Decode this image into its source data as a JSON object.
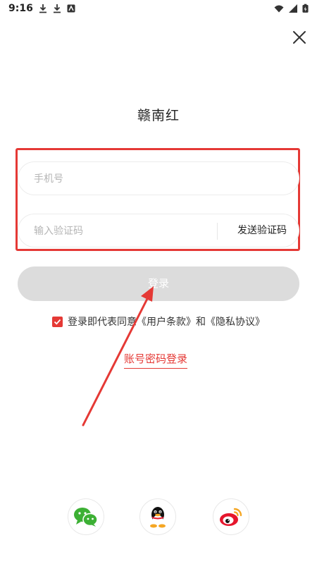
{
  "status_bar": {
    "time": "9:16"
  },
  "header": {
    "app_title": "赣南红"
  },
  "form": {
    "phone_placeholder": "手机号",
    "code_placeholder": "输入验证码",
    "send_code_label": "发送验证码",
    "login_label": "登录"
  },
  "agreement": {
    "checked": true,
    "prefix": "登录即代表同意",
    "user_terms": "《用户条款》",
    "and": "和",
    "privacy": "《隐私协议》"
  },
  "account_login_label": "账号密码登录",
  "colors": {
    "accent_red": "#e53935",
    "login_button_bg": "#dcdcdc",
    "wechat_green": "#3cb034",
    "weibo_red": "#e6162d",
    "weibo_orange": "#f5a623"
  },
  "social_icons": [
    "wechat-icon",
    "qq-icon",
    "weibo-icon"
  ]
}
